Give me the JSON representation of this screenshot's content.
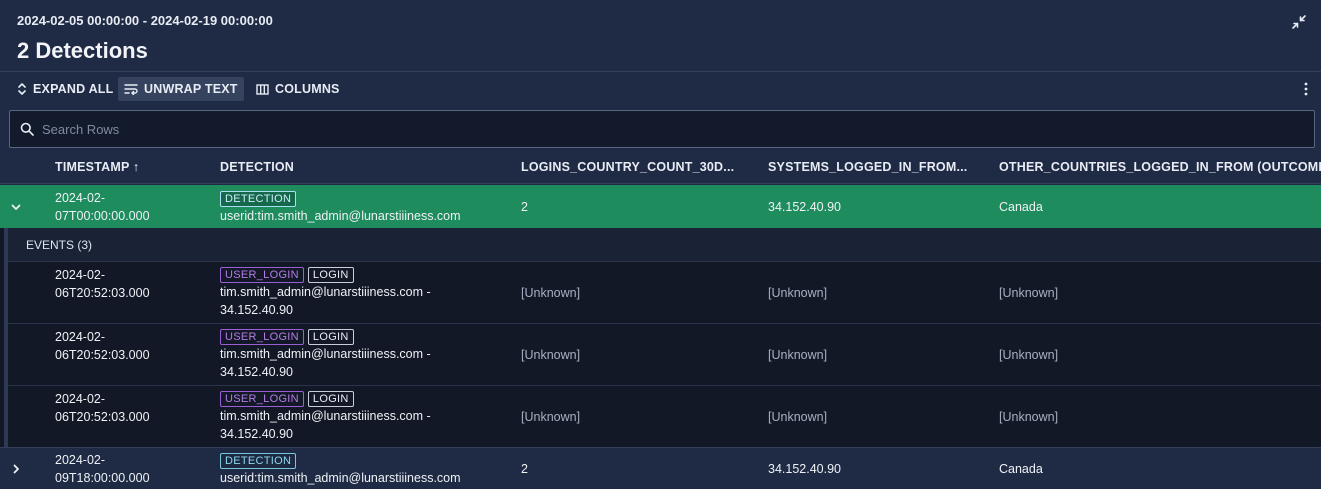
{
  "header": {
    "date_range": "2024-02-05 00:00:00 - 2024-02-19 00:00:00",
    "title": "2 Detections",
    "collapse_icon": "collapse-arrows-icon"
  },
  "toolbar": {
    "expand_all": "EXPAND ALL",
    "unwrap_text": "UNWRAP TEXT",
    "columns": "COLUMNS"
  },
  "search": {
    "placeholder": "Search Rows",
    "value": ""
  },
  "columns": [
    "TIMESTAMP ↑",
    "DETECTION",
    "LOGINS_COUNTRY_COUNT_30D...",
    "SYSTEMS_LOGGED_IN_FROM...",
    "OTHER_COUNTRIES_LOGGED_IN_FROM (OUTCOME)"
  ],
  "detections": [
    {
      "ts_line1": "2024-02-",
      "ts_line2": "07T00:00:00.000",
      "tag": "DETECTION",
      "detection": "userid:tim.smith_admin@lunarstiiiness.com",
      "logins_count": "2",
      "systems": "34.152.40.90",
      "other_countries": "Canada",
      "expanded": true
    },
    {
      "ts_line1": "2024-02-",
      "ts_line2": "09T18:00:00.000",
      "tag": "DETECTION",
      "detection": "userid:tim.smith_admin@lunarstiiiness.com",
      "logins_count": "2",
      "systems": "34.152.40.90",
      "other_countries": "Canada",
      "expanded": false
    }
  ],
  "events": {
    "label": "EVENTS (3)",
    "rows": [
      {
        "ts_line1": "2024-02-",
        "ts_line2": "06T20:52:03.000",
        "tag1": "USER_LOGIN",
        "tag2": "LOGIN",
        "line1": "tim.smith_admin@lunarstiiiness.com -",
        "line2": "34.152.40.90",
        "c3": "[Unknown]",
        "c4": "[Unknown]",
        "c5": "[Unknown]"
      },
      {
        "ts_line1": "2024-02-",
        "ts_line2": "06T20:52:03.000",
        "tag1": "USER_LOGIN",
        "tag2": "LOGIN",
        "line1": "tim.smith_admin@lunarstiiiness.com -",
        "line2": "34.152.40.90",
        "c3": "[Unknown]",
        "c4": "[Unknown]",
        "c5": "[Unknown]"
      },
      {
        "ts_line1": "2024-02-",
        "ts_line2": "06T20:52:03.000",
        "tag1": "USER_LOGIN",
        "tag2": "LOGIN",
        "line1": "tim.smith_admin@lunarstiiiness.com -",
        "line2": "34.152.40.90",
        "c3": "[Unknown]",
        "c4": "[Unknown]",
        "c5": "[Unknown]"
      }
    ]
  },
  "colors": {
    "background": "#1f2a44",
    "selected_row": "#1e8c5c",
    "events_bg": "#131826",
    "tag_user_login": "#b47be6",
    "tag_detection": "#8fd6f0"
  }
}
